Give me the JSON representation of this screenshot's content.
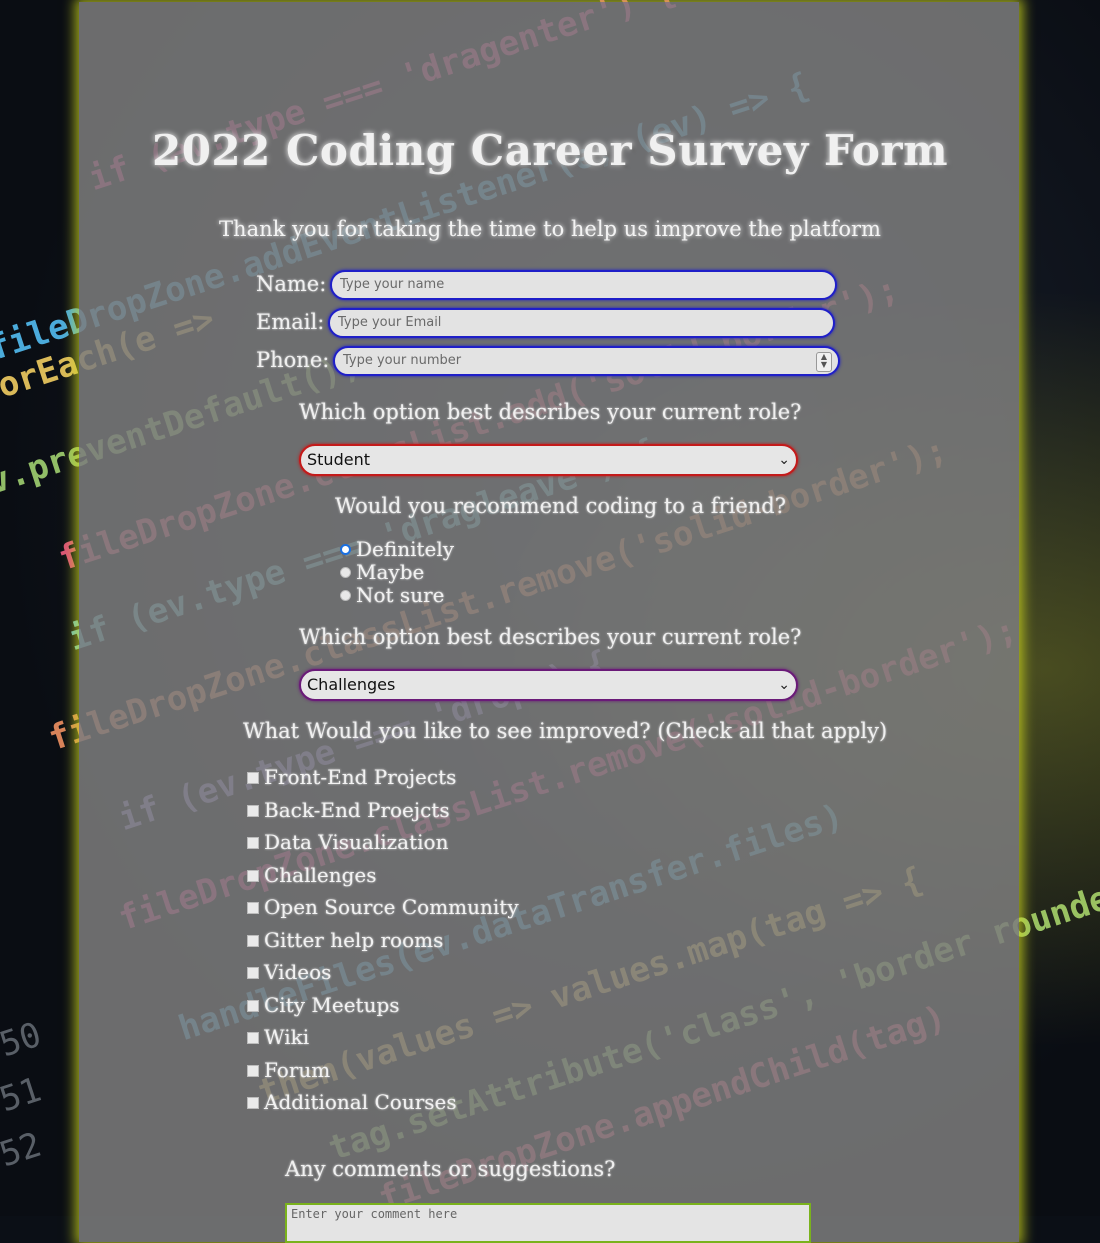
{
  "form": {
    "title": "2022 Coding Career Survey Form",
    "description": "Thank you for taking the time to help us improve the platform",
    "name": {
      "label": "Name:",
      "placeholder": "Type your name"
    },
    "email": {
      "label": "Email:",
      "placeholder": "Type your Email"
    },
    "phone": {
      "label": "Phone:",
      "placeholder": "Type your number"
    },
    "role_question": "Which option best describes your current role?",
    "role_selected": "Student",
    "recommend_question": "Would you recommend coding to a friend?",
    "recommend_options": [
      "Definitely",
      "Maybe",
      "Not sure"
    ],
    "recommend_selected": "Definitely",
    "feature_question": "Which option best describes your current role?",
    "feature_selected": "Challenges",
    "improve_question": "What Would you like to see improved? (Check all that apply)",
    "improve_options": [
      "Front-End Projects",
      "Back-End Proejcts",
      "Data Visualization",
      "Challenges",
      "Open Source Community",
      "Gitter help rooms",
      "Videos",
      "City Meetups",
      "Wiki",
      "Forum",
      "Additional Courses"
    ],
    "comments_question": "Any comments or suggestions?",
    "comments_placeholder": "Enter your comment here"
  },
  "colors": {
    "panel": "#7d7d7d",
    "panel_glow": "#d2dc1e",
    "input_border": "#1f1fc8",
    "select_role_border": "#c41a1a",
    "select_feature_border": "#6a1a78",
    "textarea_border": "#7ab21c"
  },
  "background": {
    "code_lines": [
      "if (ev.type === 'dragenter') {",
      "fileDropZone.addEventListener(e, (ev) => {",
      ".forEach(e =>",
      "ev.preventDefault();",
      "fileDropZone.classList.add('solid-border');",
      "if (ev.type === 'dragleave') {",
      "fileDropZone.classList.remove('solid-border');",
      "if (ev.type === 'drop') {",
      "fileDropZone.classList.remove('solid-border');",
      "handleFiles(ev.dataTransfer.files)",
      ".then(values => values.map(tag => {",
      "tag.setAttribute('class', 'border rounded",
      "fileDropZone.appendChild(tag)"
    ],
    "line_numbers": [
      "50",
      "51",
      "52"
    ]
  }
}
